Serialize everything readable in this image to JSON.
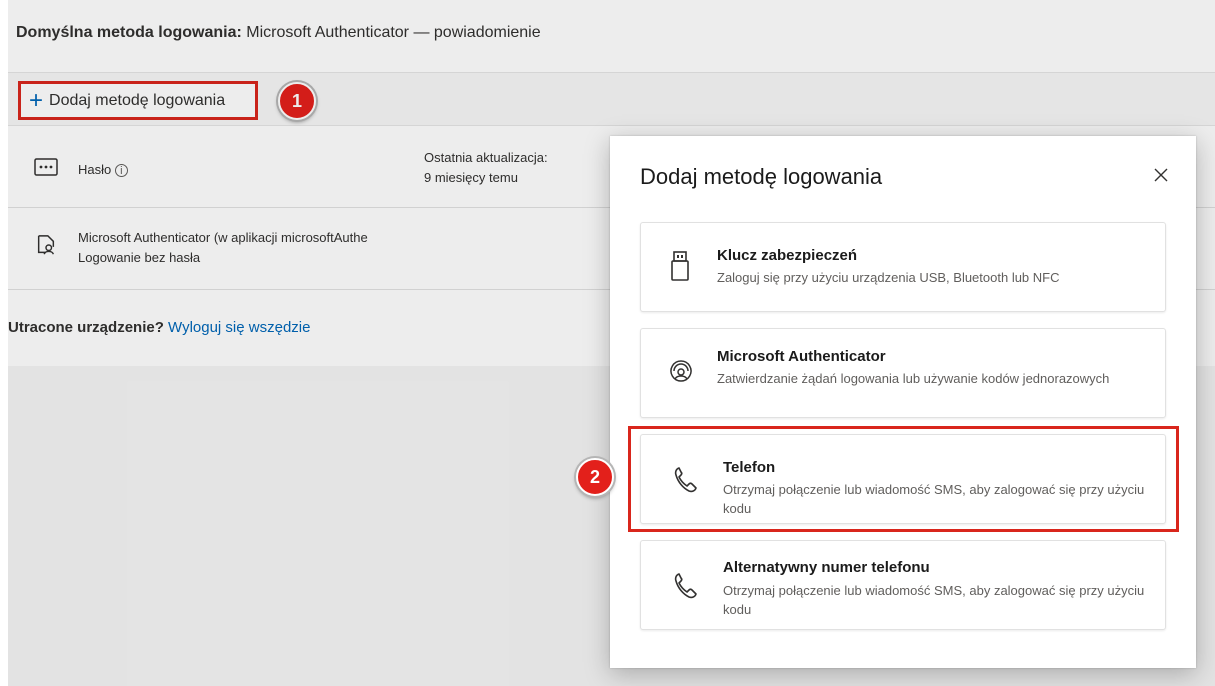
{
  "header": {
    "default_label": "Domyślna metoda logowania:",
    "default_value": "Microsoft Authenticator — powiadomienie"
  },
  "toolbar": {
    "add_label": "Dodaj metodę logowania",
    "badge1": "1"
  },
  "methods": [
    {
      "name": "Hasło",
      "update_label": "Ostatnia aktualizacja:",
      "update_value": "9 miesięcy temu",
      "icon": "password-icon"
    },
    {
      "name": "Microsoft Authenticator (w aplikacji microsoftAuthe",
      "subtitle": "Logowanie bez hasła",
      "icon": "authenticator-icon"
    }
  ],
  "lost": {
    "label": "Utracone urządzenie?",
    "link": "Wyloguj się wszędzie"
  },
  "dialog": {
    "title": "Dodaj metodę logowania",
    "badge2": "2",
    "options": [
      {
        "title": "Klucz zabezpieczeń",
        "desc": "Zaloguj się przy użyciu urządzenia USB, Bluetooth lub NFC",
        "icon": "security-key-icon"
      },
      {
        "title": "Microsoft Authenticator",
        "desc": "Zatwierdzanie żądań logowania lub używanie kodów jednorazowych",
        "icon": "authenticator-icon"
      },
      {
        "title": "Telefon",
        "desc": "Otrzymaj połączenie lub wiadomość SMS, aby zalogować się przy użyciu kodu",
        "icon": "phone-icon"
      },
      {
        "title": "Alternatywny numer telefonu",
        "desc": "Otrzymaj połączenie lub wiadomość SMS, aby zalogować się przy użyciu kodu",
        "icon": "phone-icon"
      }
    ]
  },
  "colors": {
    "accent": "#0067b8",
    "highlight": "#d9261c",
    "badge": "#e3201b"
  }
}
